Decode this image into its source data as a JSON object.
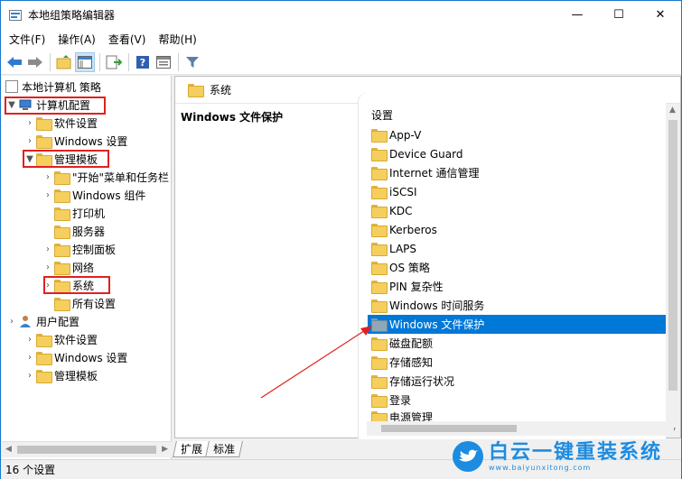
{
  "window": {
    "title": "本地组策略编辑器",
    "controls": {
      "minimize": "—",
      "maximize": "☐",
      "close": "✕"
    }
  },
  "menu": [
    "文件(F)",
    "操作(A)",
    "查看(V)",
    "帮助(H)"
  ],
  "toolbar": {
    "icons": [
      "back-icon",
      "forward-icon",
      "up-folder-icon",
      "show-hide-tree-icon",
      "export-icon",
      "help-icon",
      "properties-icon",
      "filter-icon"
    ]
  },
  "tree": {
    "root": "本地计算机 策略",
    "computer_config": "计算机配置",
    "software_settings": "软件设置",
    "windows_settings": "Windows 设置",
    "admin_templates": "管理模板",
    "start_menu": "\"开始\"菜单和任务栏",
    "windows_components": "Windows 组件",
    "printers": "打印机",
    "server": "服务器",
    "control_panel": "控制面板",
    "network": "网络",
    "system": "系统",
    "all_settings": "所有设置",
    "user_config": "用户配置",
    "user_software_settings": "软件设置",
    "user_windows_settings": "Windows 设置",
    "user_admin_templates": "管理模板"
  },
  "right": {
    "header": "系统",
    "selected_title": "Windows 文件保护",
    "list_header": "设置",
    "items": [
      "App-V",
      "Device Guard",
      "Internet 通信管理",
      "iSCSI",
      "KDC",
      "Kerberos",
      "LAPS",
      "OS 策略",
      "PIN 复杂性",
      "Windows 时间服务",
      "Windows 文件保护",
      "磁盘配额",
      "存储感知",
      "存储运行状况",
      "登录",
      "电源管理"
    ],
    "selected_index": 10
  },
  "tabs": [
    "扩展",
    "标准"
  ],
  "status": "16 个设置",
  "watermark": {
    "cn": "白云一键重装系统",
    "en": "www.baiyunxitong.com"
  },
  "colors": {
    "selection": "#0078d7",
    "highlight_box": "#e02020",
    "arrow": "#e02020"
  }
}
